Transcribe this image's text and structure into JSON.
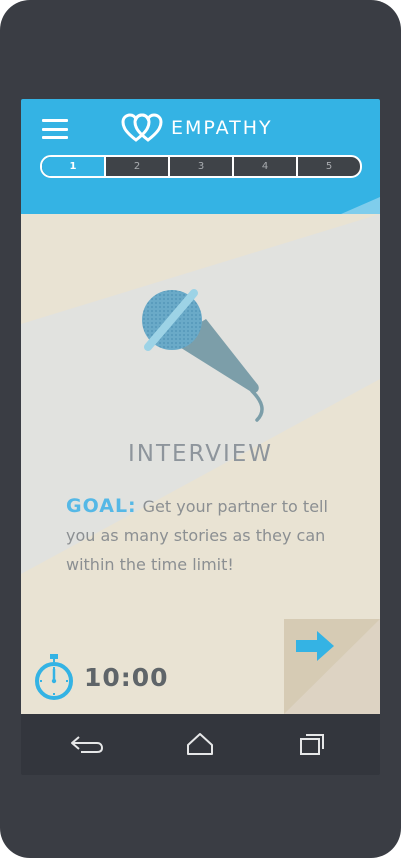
{
  "app": {
    "title": "EMPATHY"
  },
  "icons": {
    "menu": "hamburger-menu-icon",
    "logo": "double-heart-logo-icon",
    "microphone": "microphone-icon",
    "next": "right-arrow-icon",
    "timer": "stopwatch-icon",
    "back": "back-icon",
    "home": "home-icon",
    "recents": "recent-apps-icon"
  },
  "progress": {
    "current_step": 1,
    "steps": [
      "1",
      "2",
      "3",
      "4",
      "5"
    ]
  },
  "activity": {
    "title": "INTERVIEW",
    "goal_label": "GOAL:",
    "goal_text": "Get your partner to tell you as many stories as they can within the time limit!"
  },
  "timer": {
    "value": "10:00"
  },
  "colors": {
    "accent": "#34b3e4",
    "frame": "#3a3d44",
    "background": "#e9e3d3",
    "band": "#e1e2df",
    "text_muted": "#8b8f92"
  }
}
